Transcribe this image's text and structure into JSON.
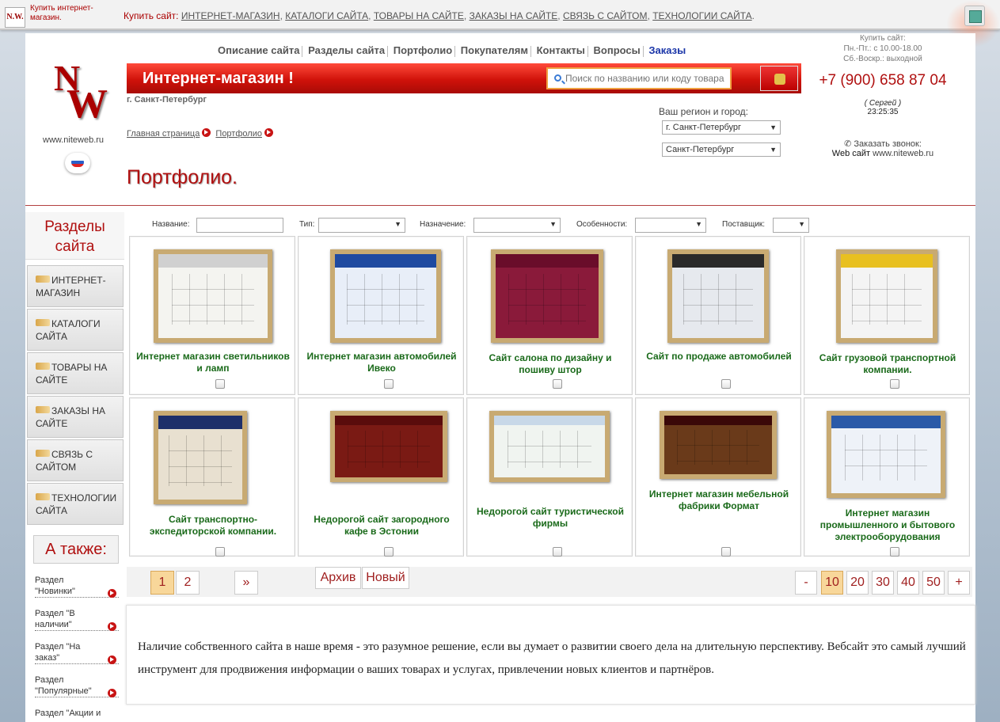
{
  "topbar": {
    "mini_logo": "N.W.",
    "mini_text": "Купить интернет-магазин.",
    "prefix": "Купить сайт:",
    "links": [
      "ИНТЕРНЕТ-МАГАЗИН",
      "КАТАЛОГИ САЙТА",
      "ТОВАРЫ НА САЙТЕ",
      "ЗАКАЗЫ НА САЙТЕ",
      "СВЯЗЬ С САЙТОМ",
      "ТЕХНОЛОГИИ САЙТА"
    ],
    "sep": ",",
    "end": "."
  },
  "logo": {
    "n": "N",
    "w": "W",
    "url": "www.niteweb.ru"
  },
  "nav": [
    "Описание сайта",
    "Разделы сайта",
    "Портфолио",
    "Покупателям",
    "Контакты",
    "Вопросы",
    "Заказы"
  ],
  "banner": {
    "title": "Интернет-магазин !",
    "search_placeholder": "Поиск по названию или коду товара",
    "city": "г. Санкт-Петербург"
  },
  "breadcrumbs": [
    "Главная страница",
    "Портфолио"
  ],
  "page_title": "Портфолио.",
  "region": {
    "label": "Ваш регион и город:",
    "region_value": "г. Санкт-Петербург",
    "city_value": "Санкт-Петербург"
  },
  "contact": {
    "buy_line1": "Купить сайт:",
    "buy_line2": "Пн.-Пт.: с 10.00-18.00",
    "buy_line3": "Сб.-Воскр.: выходной",
    "phone": "+7 (900) 658 87 04",
    "person": "( Сергей )",
    "time": "23:25:35",
    "call": "Заказать звонок:",
    "web_prefix": "Web сайт",
    "web_url": "www.niteweb.ru"
  },
  "sidebar": {
    "title": "Разделы сайта",
    "items": [
      {
        "line1": "ИНТЕРНЕТ-",
        "line2": "МАГАЗИН"
      },
      {
        "line1": "КАТАЛОГИ",
        "line2": "САЙТА"
      },
      {
        "line1": "ТОВАРЫ НА",
        "line2": "САЙТЕ"
      },
      {
        "line1": "ЗАКАЗЫ НА",
        "line2": "САЙТЕ"
      },
      {
        "line1": "СВЯЗЬ С",
        "line2": "САЙТОМ"
      },
      {
        "line1": "ТЕХНОЛОГИИ",
        "line2": "САЙТА"
      }
    ],
    "also_title": "А также:",
    "also_items": [
      {
        "line1": "Раздел",
        "line2": "\"Новинки\""
      },
      {
        "line1": "Раздел \"В",
        "line2": "наличии\""
      },
      {
        "line1": "Раздел \"На",
        "line2": "заказ\""
      },
      {
        "line1": "Раздел",
        "line2": "\"Популярные\""
      },
      {
        "line1": "Раздел \"Акции и",
        "line2": ""
      }
    ]
  },
  "filters": {
    "name_label": "Название:",
    "type_label": "Тип:",
    "purpose_label": "Назначение:",
    "features_label": "Особенности:",
    "supplier_label": "Поставщик:"
  },
  "portfolio": [
    {
      "title": "Интернет магазин светильников и ламп",
      "top": "#d0d0d0",
      "body": "#f4f4f0"
    },
    {
      "title": "Интернет магазин автомобилей Ивеко",
      "top": "#1f4aa0",
      "body": "#e8eef8"
    },
    {
      "title": "Сайт салона по дизайну и пошиву штор",
      "top": "#6a0d2a",
      "body": "#8a1a3a"
    },
    {
      "title": "Сайт по продаже автомобилей",
      "top": "#2a2a2a",
      "body": "#e6e9ee"
    },
    {
      "title": "Сайт грузовой транспортной компании.",
      "top": "#e8c020",
      "body": "#f4f4f4"
    },
    {
      "title": "Сайт транспортно-экспедиторской компании.",
      "top": "#1d2f6a",
      "body": "#e8e0d0"
    },
    {
      "title": "Недорогой сайт загородного кафе в Эстонии",
      "top": "#5a0c0c",
      "body": "#7a1a14"
    },
    {
      "title": "Недорогой сайт туристической фирмы",
      "top": "#c8d8e8",
      "body": "#f0f4f0"
    },
    {
      "title": "Интернет магазин мебельной фабрики Формат",
      "top": "#3a0808",
      "body": "#6a3a1a"
    },
    {
      "title": "Интернет магазин промышленного и бытового электрооборудования",
      "top": "#2a5aa8",
      "body": "#eef2f8"
    }
  ],
  "pager": {
    "pages": [
      "1",
      "2"
    ],
    "current": "1",
    "next": "»",
    "archive": "Архив",
    "new": "Новый",
    "minus": "-",
    "sizes": [
      "10",
      "20",
      "30",
      "40",
      "50"
    ],
    "current_size": "10",
    "plus": "+"
  },
  "description": "Наличие собственного сайта в наше время - это разумное решение, если вы думает о развитии своего дела на длительную перспективу. Вебсайт это самый лучший инструмент для продвижения информации о ваших товарах и услугах, привлечении новых клиентов и партнёров.",
  "colors": {
    "accent": "#b01010",
    "banner": "#d0120a",
    "title_green": "#1a6a1a",
    "nav_active": "#1a35a8"
  }
}
